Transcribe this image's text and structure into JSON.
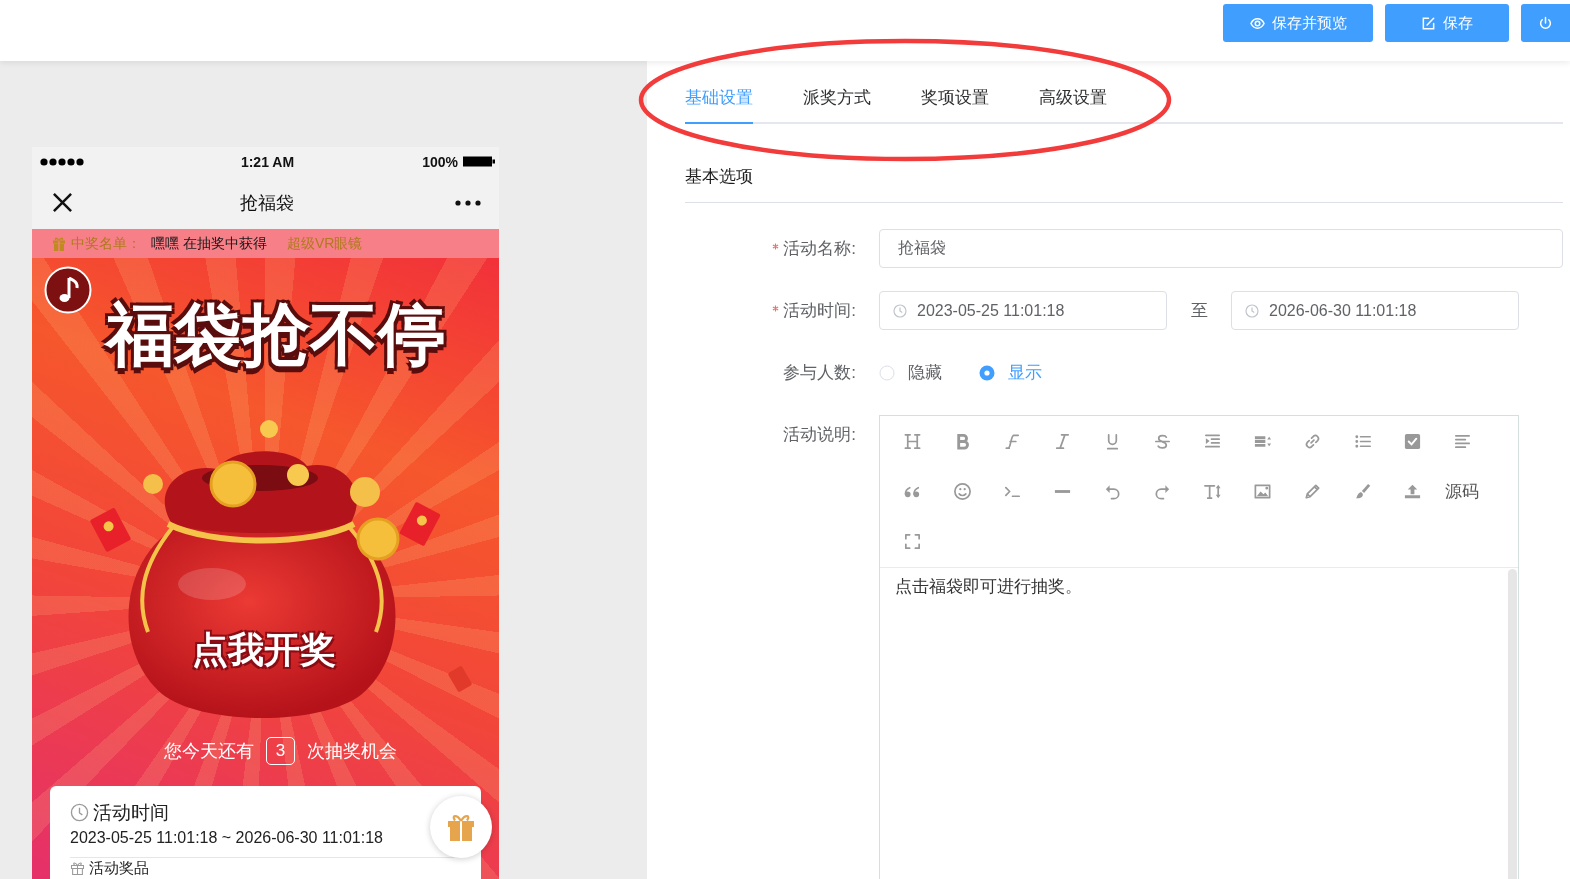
{
  "header": {
    "buttons": [
      {
        "kind": "preview",
        "label": "保存并预览"
      },
      {
        "kind": "save",
        "label": "保存"
      },
      {
        "kind": "power"
      }
    ]
  },
  "phone": {
    "status_bar": {
      "time": "1:21 AM",
      "battery": "100%"
    },
    "nav_bar": {
      "title": "抢福袋"
    },
    "ticker": {
      "label": "中奖名单：",
      "message": "嘿嘿 在抽奖中获得",
      "prize": "超级VR眼镜"
    },
    "poster": {
      "title": "福袋抢不停",
      "button": "点我开奖"
    },
    "chances": {
      "before": "您今天还有",
      "count": "3",
      "after": "次抽奖机会"
    },
    "info_card": {
      "sections": [
        {
          "kind": "time",
          "title": "活动时间",
          "text": "2023-05-25 11:01:18 ~ 2026-06-30 11:01:18"
        },
        {
          "kind": "prize",
          "title": "活动奖品"
        }
      ]
    }
  },
  "tabs": [
    {
      "label": "基础设置",
      "selected": true
    },
    {
      "label": "派奖方式",
      "selected": false
    },
    {
      "label": "奖项设置",
      "selected": false
    },
    {
      "label": "高级设置",
      "selected": false
    }
  ],
  "annotations": [
    {
      "kind": "ellipse"
    }
  ],
  "section_title": "基本选项",
  "form": {
    "fields": [
      {
        "kind": "text",
        "label": "活动名称:",
        "required": true,
        "value": "抢福袋"
      },
      {
        "kind": "date_range",
        "label": "活动时间:",
        "required": true,
        "start": "2023-05-25 11:01:18",
        "separator": "至",
        "end": "2026-06-30 11:01:18"
      },
      {
        "kind": "radio",
        "label": "参与人数:",
        "required": false,
        "options": [
          {
            "label": "隐藏",
            "selected": false
          },
          {
            "label": "显示",
            "selected": true
          }
        ]
      },
      {
        "kind": "editor",
        "label": "活动说明:",
        "required": false,
        "toolbar": [
          {
            "kind": "heading"
          },
          {
            "kind": "bold"
          },
          {
            "kind": "font"
          },
          {
            "kind": "italic"
          },
          {
            "kind": "underline"
          },
          {
            "kind": "strike"
          },
          {
            "kind": "indent"
          },
          {
            "kind": "lineheight"
          },
          {
            "kind": "link"
          },
          {
            "kind": "list"
          },
          {
            "kind": "todo"
          },
          {
            "kind": "align"
          },
          {
            "kind": "quote"
          },
          {
            "kind": "emoji"
          },
          {
            "kind": "code"
          },
          {
            "kind": "hr"
          },
          {
            "kind": "undo"
          },
          {
            "kind": "redo"
          },
          {
            "kind": "fontsize"
          },
          {
            "kind": "image"
          },
          {
            "kind": "pen"
          },
          {
            "kind": "brush"
          },
          {
            "kind": "upload"
          },
          {
            "kind": "source",
            "label": "源码"
          },
          {
            "kind": "fullscreen"
          }
        ],
        "content": "点击福袋即可进行抽奖。"
      }
    ]
  }
}
